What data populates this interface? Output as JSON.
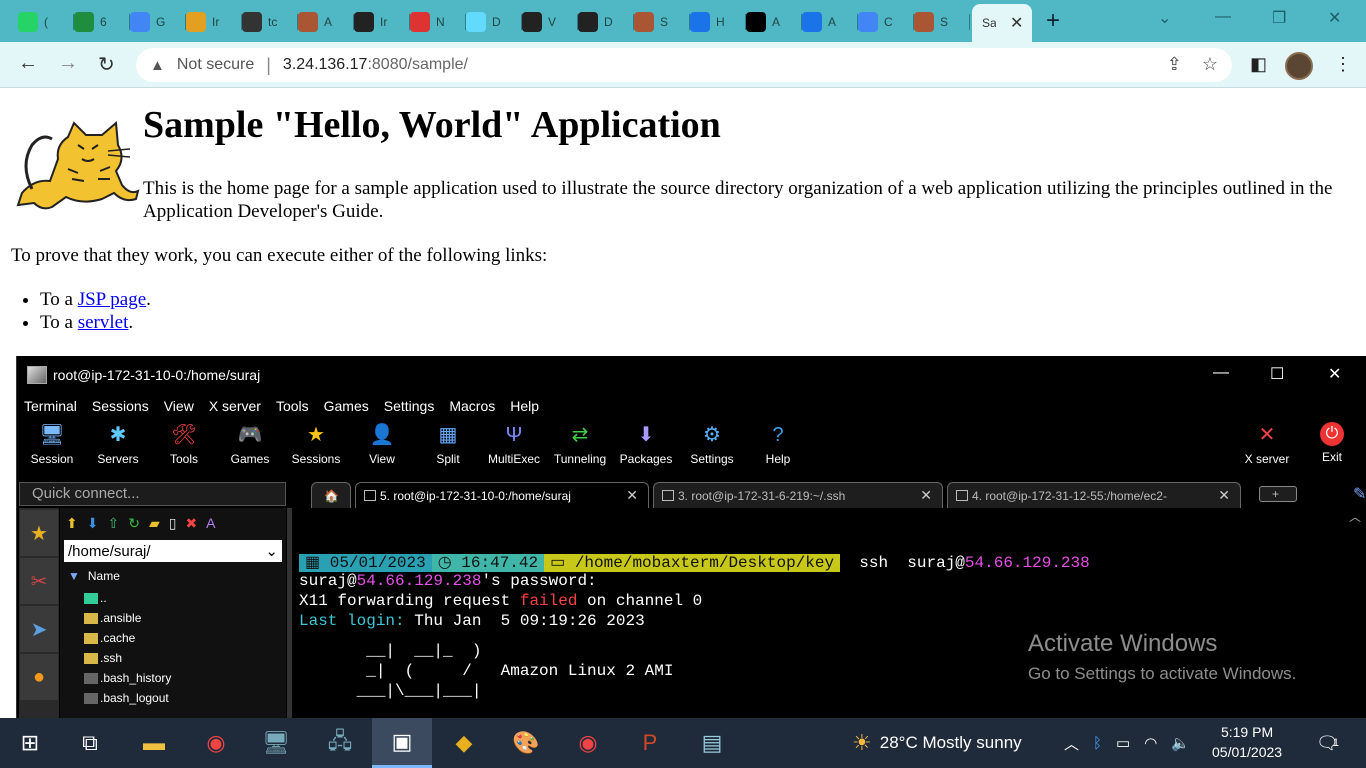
{
  "browser": {
    "tabs": [
      {
        "icon": "whatsapp-icon",
        "label": "(",
        "color": "#25d366"
      },
      {
        "icon": "sheets-icon",
        "label": "6",
        "color": "#1e8e3e"
      },
      {
        "icon": "photos-icon",
        "label": "G",
        "color": "#4285f4"
      },
      {
        "icon": "package-icon",
        "label": "Ir",
        "color": "#e3a020"
      },
      {
        "icon": "globe-icon",
        "label": "tc",
        "color": "#333333"
      },
      {
        "icon": "thumbnail-icon",
        "label": "A",
        "color": "#aa5533"
      },
      {
        "icon": "github-globe-icon",
        "label": "Ir",
        "color": "#222222"
      },
      {
        "icon": "pen-icon",
        "label": "N",
        "color": "#d33"
      },
      {
        "icon": "react-icon",
        "label": "D",
        "color": "#61dafb"
      },
      {
        "icon": "github-globe-icon",
        "label": "V",
        "color": "#222222"
      },
      {
        "icon": "github-icon",
        "label": "D",
        "color": "#222222"
      },
      {
        "icon": "thumbnail-icon",
        "label": "S",
        "color": "#aa5533"
      },
      {
        "icon": "maps-icon",
        "label": "H",
        "color": "#1a73e8"
      },
      {
        "icon": "angular-icon",
        "label": "A",
        "color": "#000000"
      },
      {
        "icon": "mw-icon",
        "label": "A",
        "color": "#1a73e8"
      },
      {
        "icon": "photos-icon",
        "label": "C",
        "color": "#4285f4"
      },
      {
        "icon": "thumbnail-icon",
        "label": "S",
        "color": "#aa5533"
      }
    ],
    "active_tab": {
      "label": "Sa",
      "close": "✕"
    },
    "new_tab": "+",
    "address": {
      "security": "Not secure",
      "host": "3.24.136.17",
      "path": ":8080/sample/"
    }
  },
  "page": {
    "heading": "Sample \"Hello, World\" Application",
    "intro": "This is the home page for a sample application used to illustrate the source directory organization of a web application utilizing the principles outlined in the Application Developer's Guide.",
    "prove": "To prove that they work, you can execute either of the following links:",
    "links": [
      {
        "prefix": "To a ",
        "link": "JSP page",
        "suffix": "."
      },
      {
        "prefix": "To a ",
        "link": "servlet",
        "suffix": "."
      }
    ]
  },
  "moba": {
    "title": "root@ip-172-31-10-0:/home/suraj",
    "menu": [
      "Terminal",
      "Sessions",
      "View",
      "X server",
      "Tools",
      "Games",
      "Settings",
      "Macros",
      "Help"
    ],
    "tools": [
      {
        "label": "Session",
        "icon": "session-icon",
        "glyph": "🖥"
      },
      {
        "label": "Servers",
        "icon": "servers-icon",
        "glyph": "✱"
      },
      {
        "label": "Tools",
        "icon": "tools-icon",
        "glyph": "🛠"
      },
      {
        "label": "Games",
        "icon": "games-icon",
        "glyph": "🎮"
      },
      {
        "label": "Sessions",
        "icon": "sessions-star-icon",
        "glyph": "★"
      },
      {
        "label": "View",
        "icon": "view-icon",
        "glyph": "👤"
      },
      {
        "label": "Split",
        "icon": "split-icon",
        "glyph": "▦"
      },
      {
        "label": "MultiExec",
        "icon": "multiexec-icon",
        "glyph": "Ψ"
      },
      {
        "label": "Tunneling",
        "icon": "tunneling-icon",
        "glyph": "⇄"
      },
      {
        "label": "Packages",
        "icon": "packages-icon",
        "glyph": "⬇"
      },
      {
        "label": "Settings",
        "icon": "settings-icon",
        "glyph": "⚙"
      },
      {
        "label": "Help",
        "icon": "help-icon",
        "glyph": "?"
      }
    ],
    "xserver": "X server",
    "exit": "Exit",
    "quick_connect": "Quick connect...",
    "path": "/home/suraj/",
    "name_column": "Name",
    "files": [
      {
        "name": "..",
        "type": "parent"
      },
      {
        "name": ".ansible",
        "type": "folder"
      },
      {
        "name": ".cache",
        "type": "folder"
      },
      {
        "name": ".ssh",
        "type": "folder"
      },
      {
        "name": ".bash_history",
        "type": "file"
      },
      {
        "name": ".bash_logout",
        "type": "file"
      }
    ],
    "term_tabs": [
      {
        "label": "5. root@ip-172-31-10-0:/home/suraj",
        "active": true
      },
      {
        "label": "3. root@ip-172-31-6-219:~/.ssh",
        "active": false
      },
      {
        "label": "4. root@ip-172-31-12-55:/home/ec2-",
        "active": false
      }
    ],
    "terminal": {
      "prompt_date": "05/01/2023",
      "prompt_time": "16:47.42",
      "prompt_dir": "/home/mobaxterm/Desktop/key",
      "cmd": "ssh  suraj@",
      "cmd_host": "54.66.129.238",
      "l2_user": "suraj@",
      "l2_host": "54.66.129.238",
      "l2_rest": "'s password:",
      "l3_a": "X11 forwarding request ",
      "l3_failed": "failed",
      "l3_b": " on channel 0",
      "l4_label": "Last login:",
      "l4_rest": " Thu Jan  5 09:19:26 2023",
      "art1": "       __|  __|_  )",
      "art2": "       _|  (     /   Amazon Linux 2 AMI",
      "art3": "      ___|\\___|___|"
    },
    "activate_title": "Activate Windows",
    "activate_sub": "Go to Settings to activate Windows."
  },
  "taskbar": {
    "weather": "28°C  Mostly sunny",
    "time": "5:19 PM",
    "date": "05/01/2023",
    "notifications": "1"
  }
}
